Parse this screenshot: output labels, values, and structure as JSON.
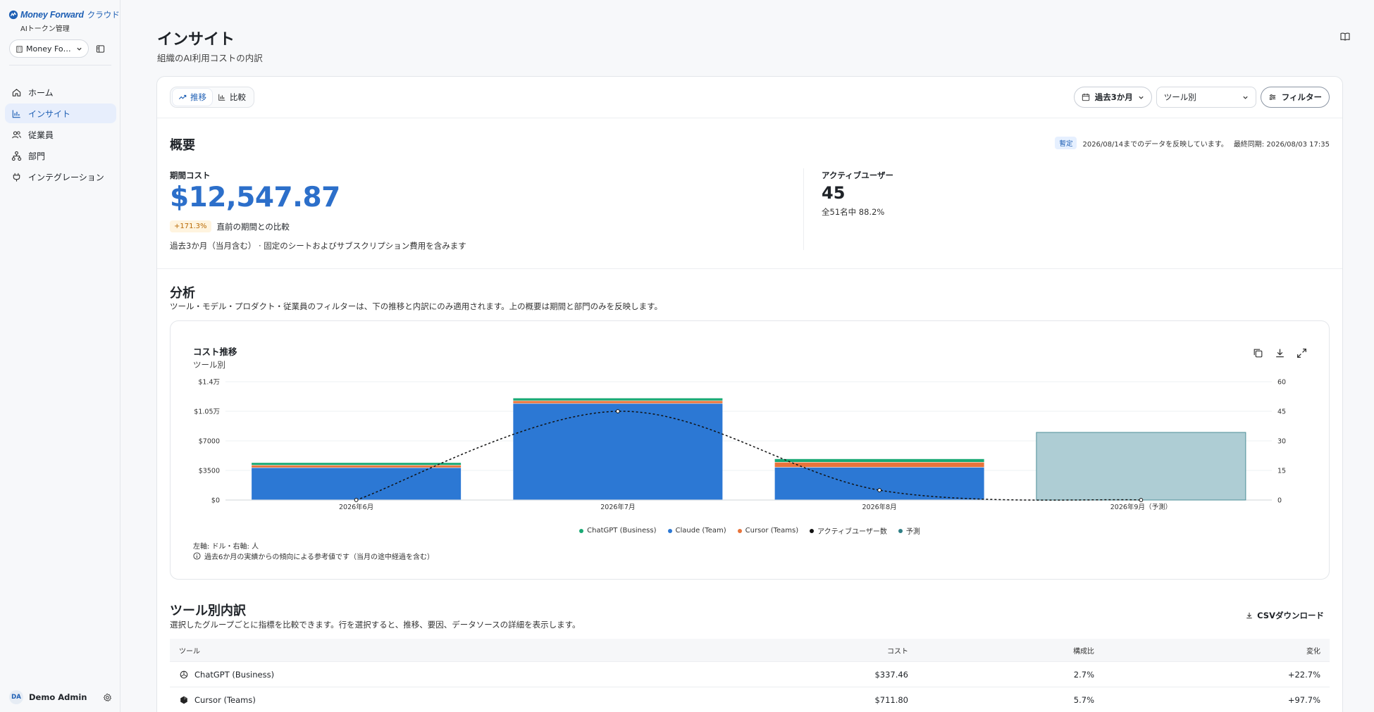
{
  "brand": {
    "name": "Money Forward",
    "suffix": "クラウド",
    "sub": "AIトークン管理"
  },
  "org": {
    "label": "Money Fo…"
  },
  "nav": [
    {
      "label": "ホーム",
      "icon": "home-icon"
    },
    {
      "label": "インサイト",
      "icon": "bar-chart-icon",
      "active": true
    },
    {
      "label": "従業員",
      "icon": "users-icon"
    },
    {
      "label": "部門",
      "icon": "org-tree-icon"
    },
    {
      "label": "インテグレーション",
      "icon": "plug-icon"
    }
  ],
  "user": {
    "initials": "DA",
    "name": "Demo Admin"
  },
  "page": {
    "title": "インサイト",
    "subtitle": "組織のAI利用コストの内訳"
  },
  "toolbar": {
    "tabs": [
      {
        "label": "推移",
        "active": true
      },
      {
        "label": "比較"
      }
    ],
    "period": "過去3か月",
    "group_by": "ツール別",
    "filter": "フィルター"
  },
  "summary": {
    "title": "概要",
    "status_badge": "暫定",
    "status_text": "2026/08/14までのデータを反映しています。",
    "last_sync": "最終同期: 2026/08/03 17:35",
    "cost_label": "期間コスト",
    "cost_value": "$12,547.87",
    "change_badge": "+171.3%",
    "change_text": "直前の期間との比較",
    "note": "過去3か月（当月含む） · 固定のシートおよびサブスクリプション費用を含みます",
    "users_label": "アクティブユーザー",
    "users_value": "45",
    "users_sub": "全51名中 88.2%"
  },
  "analysis": {
    "title": "分析",
    "subtitle": "ツール・モデル・プロダクト・従業員のフィルターは、下の推移と内訳にのみ適用されます。上の概要は期間と部門のみを反映します。"
  },
  "chart": {
    "title": "コスト推移",
    "subtitle": "ツール別",
    "note_axes": "左軸: ドル・右軸: 人",
    "note_forecast": "過去6か月の実績からの傾向による参考値です（当月の途中経過を含む）"
  },
  "chart_data": {
    "type": "bar",
    "stacked": true,
    "categories": [
      "2026年6月",
      "2026年7月",
      "2026年8月",
      "2026年9月（予測）"
    ],
    "y_left": {
      "ticks": [
        "$0",
        "$3500",
        "$7000",
        "$1.05万",
        "$1.4万"
      ],
      "min": 0,
      "max": 14000
    },
    "y_right": {
      "ticks": [
        "0",
        "15",
        "30",
        "45",
        "60"
      ],
      "min": 0,
      "max": 60
    },
    "series": [
      {
        "name": "Claude (Team)",
        "type": "bar",
        "color": "#2c78d4",
        "values": [
          3800,
          11400,
          3850,
          null
        ]
      },
      {
        "name": "Cursor (Teams)",
        "type": "bar",
        "color": "#e8743b",
        "values": [
          300,
          320,
          600,
          null
        ]
      },
      {
        "name": "ChatGPT (Business)",
        "type": "bar",
        "color": "#19a974",
        "values": [
          300,
          320,
          400,
          null
        ]
      },
      {
        "name": "予測",
        "type": "bar",
        "color": "#aecdd4",
        "values": [
          null,
          null,
          null,
          8000
        ]
      },
      {
        "name": "アクティブユーザー数",
        "type": "line",
        "axis": "right",
        "dashed": true,
        "color": "#111111",
        "values": [
          0,
          45,
          5,
          0
        ]
      }
    ],
    "legend": [
      {
        "name": "ChatGPT (Business)",
        "color": "#19a974"
      },
      {
        "name": "Claude (Team)",
        "color": "#2c78d4"
      },
      {
        "name": "Cursor (Teams)",
        "color": "#e8743b"
      },
      {
        "name": "アクティブユーザー数",
        "color": "#111111"
      },
      {
        "name": "予測",
        "color": "#2f7f86"
      }
    ],
    "grid": true,
    "legend_position": "bottom"
  },
  "breakdown": {
    "title": "ツール別内訳",
    "subtitle": "選択したグループごとに指標を比較できます。行を選択すると、推移、要因、データソースの詳細を表示します。",
    "csv_label": "CSVダウンロード",
    "columns": [
      "ツール",
      "コスト",
      "構成比",
      "変化"
    ],
    "rows": [
      {
        "tool": "ChatGPT (Business)",
        "icon": "openai-icon",
        "cost": "$337.46",
        "share": "2.7%",
        "change": "+22.7%"
      },
      {
        "tool": "Cursor (Teams)",
        "icon": "cursor-icon",
        "cost": "$711.80",
        "share": "5.7%",
        "change": "+97.7%"
      }
    ]
  }
}
